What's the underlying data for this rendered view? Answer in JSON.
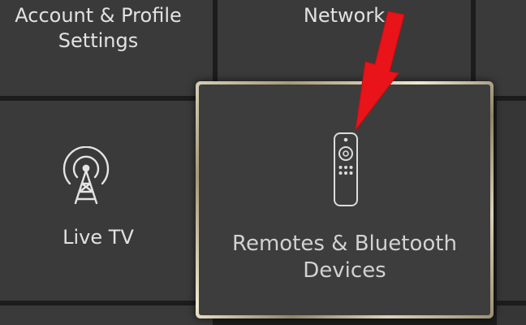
{
  "tiles": {
    "account_profile": {
      "label": "Account & Profile\nSettings"
    },
    "network": {
      "label": "Network"
    },
    "live_tv": {
      "label": "Live TV",
      "icon": "antenna-icon"
    },
    "remotes_bluetooth": {
      "label": "Remotes & Bluetooth\nDevices",
      "icon": "remote-icon",
      "focused": true
    }
  },
  "annotation": {
    "type": "arrow",
    "color": "#e8141a",
    "points_to": "remote-icon"
  },
  "colors": {
    "background": "#1c1c1c",
    "tile": "#3a3a3a",
    "focus_border": "#d7cfb6",
    "text": "#e2e2e2",
    "annotation_arrow": "#e8141a"
  }
}
